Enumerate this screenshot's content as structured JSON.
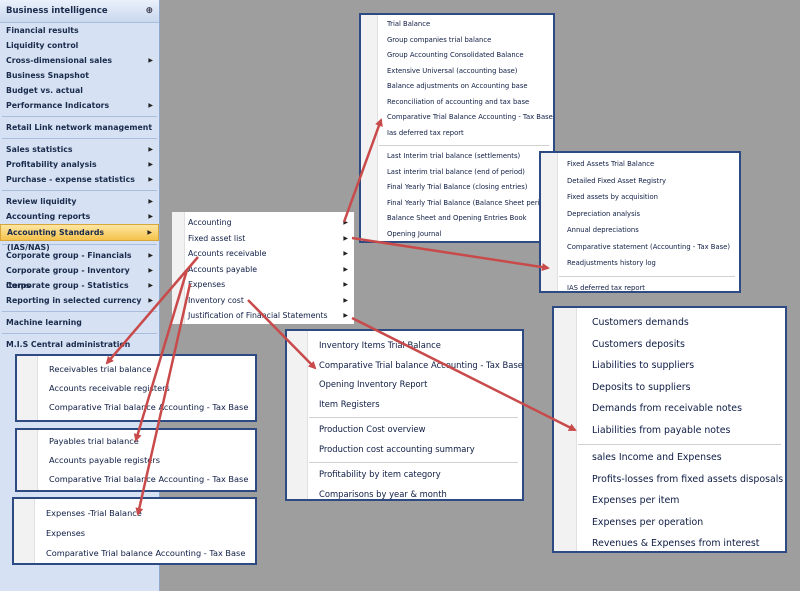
{
  "sidebar": {
    "header": "Business intelligence",
    "groups": [
      [
        {
          "label": "Financial results",
          "sub": false
        },
        {
          "label": "Liquidity control",
          "sub": false
        },
        {
          "label": "Cross-dimensional sales",
          "sub": true
        },
        {
          "label": "Business Snapshot",
          "sub": false
        },
        {
          "label": "Budget vs. actual",
          "sub": false
        },
        {
          "label": "Performance Indicators",
          "sub": true
        }
      ],
      [
        {
          "label": "Retail Link network management",
          "sub": false
        }
      ],
      [
        {
          "label": "Sales statistics",
          "sub": true
        },
        {
          "label": "Profitability analysis",
          "sub": true
        },
        {
          "label": "Purchase - expense statistics",
          "sub": true
        }
      ],
      [
        {
          "label": "Review liquidity",
          "sub": true
        },
        {
          "label": "Accounting reports",
          "sub": true
        },
        {
          "label": "Accounting Standards (IAS/NAS)",
          "sub": true,
          "active": true
        }
      ],
      [
        {
          "label": "Corporate group - Financials",
          "sub": true
        },
        {
          "label": "Corporate group - Inventory items",
          "sub": true
        },
        {
          "label": "Corporate group - Statistics",
          "sub": true
        },
        {
          "label": "Reporting in selected currency",
          "sub": true
        }
      ],
      [
        {
          "label": "Machine learning",
          "sub": false
        }
      ],
      [
        {
          "label": "M.I.S Central administration",
          "sub": false
        }
      ]
    ]
  },
  "main_submenu": {
    "items": [
      {
        "label": "Accounting",
        "sub": true
      },
      {
        "label": "Fixed asset list",
        "sub": true
      },
      {
        "label": "Accounts receivable",
        "sub": true
      },
      {
        "label": "Accounts payable",
        "sub": true
      },
      {
        "label": "Expenses",
        "sub": true
      },
      {
        "label": "Inventory cost",
        "sub": true
      },
      {
        "label": "Justification of Financial Statements",
        "sub": true
      }
    ]
  },
  "accounting_menu": {
    "groups": [
      [
        "Trial Balance",
        "Group companies trial balance",
        "Group Accounting Consolidated Balance",
        "Extensive Universal (accounting base)",
        "Balance adjustments on Accounting base",
        "Reconciliation of accounting and tax base",
        "Comparative Trial Balance Accounting - Tax Base",
        "Ias deferred tax report"
      ],
      [
        "Last Interim trial balance (settlements)",
        "Last interim trial balance (end of period)",
        "Final Yearly Trial Balance (closing entries)",
        "Final Yearly Trial Balance (Balance Sheet period)",
        "Balance Sheet and Opening Entries Book",
        "Opening Journal"
      ]
    ]
  },
  "fixed_assets_menu": {
    "groups": [
      [
        "Fixed Assets Trial Balance",
        "Detailed Fixed Asset Registry",
        "Fixed assets by acquisition",
        "Depreciation analysis",
        "Annual depreciations",
        "Comparative statement (Accounting - Tax Base)",
        "Readjustments history log"
      ],
      [
        "IAS deferred tax report"
      ]
    ]
  },
  "receivable_menu": {
    "groups": [
      [
        "Receivables trial balance",
        "Accounts receivable registers",
        "Comparative Trial balance Accounting - Tax Base"
      ]
    ]
  },
  "payable_menu": {
    "groups": [
      [
        "Payables trial balance",
        "Accounts payable registers",
        "Comparative Trial balance Accounting - Tax Base"
      ]
    ]
  },
  "expenses_menu": {
    "groups": [
      [
        "Expenses -Trial Balance",
        "Expenses",
        "Comparative Trial balance Accounting - Tax Base"
      ]
    ]
  },
  "inventory_menu": {
    "groups": [
      [
        "Inventory Items Trial Balance",
        "Comparative Trial balance Accounting - Tax Base",
        "Opening Inventory Report",
        "Item Registers"
      ],
      [
        "Production Cost overview",
        "Production cost accounting summary"
      ],
      [
        "Profitability by item category",
        "Comparisons by year & month"
      ]
    ]
  },
  "justification_menu": {
    "groups": [
      [
        "Customers demands",
        "Customers deposits",
        "Liabilities to suppliers",
        "Deposits to suppliers",
        "Demands from receivable notes",
        "Liabilities from payable notes"
      ],
      [
        "sales Income and Expenses",
        "Profits-losses from fixed assets disposals",
        "Expenses per item",
        "Expenses per operation",
        "Revenues & Expenses from interest"
      ]
    ]
  },
  "colors": {
    "arrow": "#c94a4a",
    "box_border": "#2e4a82",
    "sidebar_bg": "#d6e2f3",
    "active_bg": "#f5c24b",
    "text": "#0e1c44"
  }
}
